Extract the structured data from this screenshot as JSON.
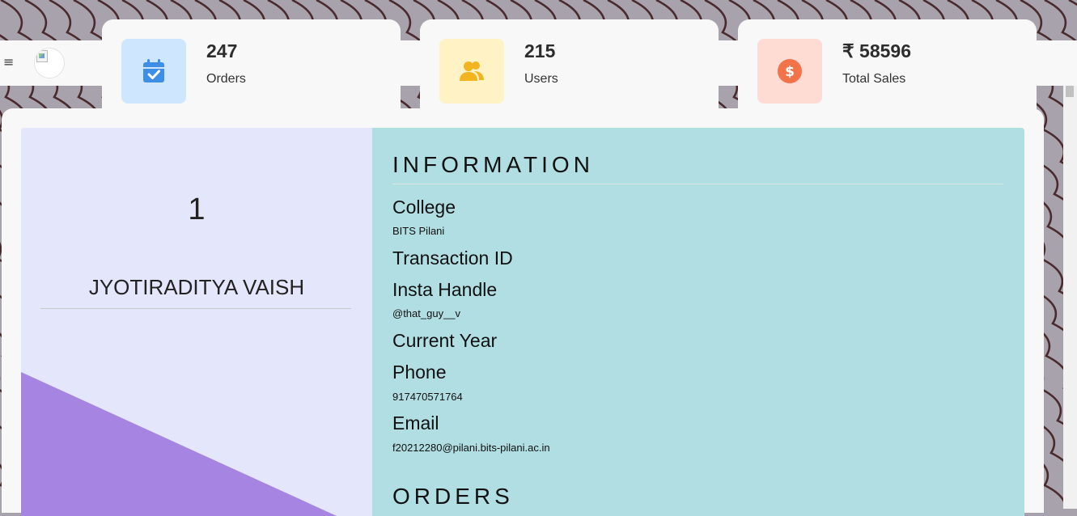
{
  "navbar": {
    "menu_icon": "≡",
    "logo_icon": "broken-image-icon"
  },
  "stats": [
    {
      "value": "247",
      "label": "Orders",
      "icon": "calendar-check-icon",
      "icon_bg": "#cfe6ff",
      "icon_color": "#3f8ee6"
    },
    {
      "value": "215",
      "label": "Users",
      "icon": "users-icon",
      "icon_bg": "#fff2c4",
      "icon_color": "#f2b51f"
    },
    {
      "value": "₹ 58596",
      "label": "Total Sales",
      "icon": "dollar-icon",
      "icon_bg": "#ffdcd3",
      "icon_color": "#f2734a"
    }
  ],
  "profile": {
    "index": "1",
    "name": "JYOTIRADITYA VAISH",
    "card_color": "#e4e7fb",
    "accent_color": "#a684e1"
  },
  "information": {
    "heading": "INFORMATION",
    "panel_color": "#b0dee3",
    "fields": [
      {
        "label": "College",
        "value": "BITS Pilani"
      },
      {
        "label": "Transaction ID",
        "value": ""
      },
      {
        "label": "Insta Handle",
        "value": "@that_guy__v"
      },
      {
        "label": "Current Year",
        "value": ""
      },
      {
        "label": "Phone",
        "value": "917470571764"
      },
      {
        "label": "Email",
        "value": "f20212280@pilani.bits-pilani.ac.in"
      }
    ]
  },
  "orders": {
    "heading": "ORDERS"
  }
}
